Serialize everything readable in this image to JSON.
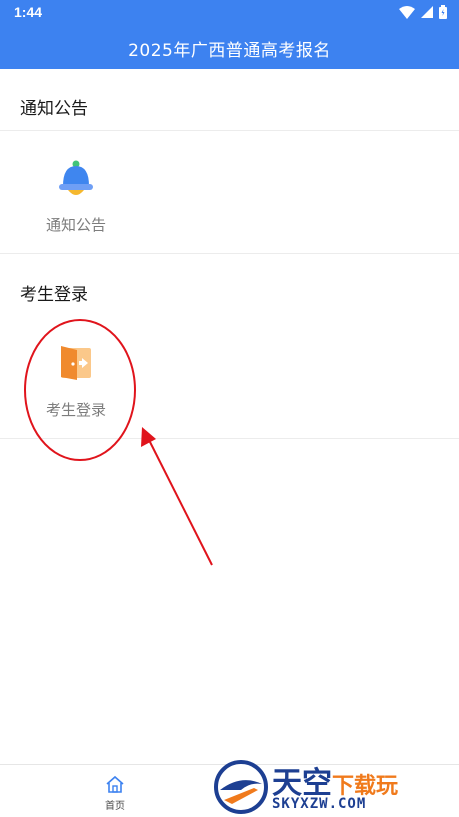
{
  "status_bar": {
    "time": "1:44"
  },
  "header": {
    "title": "2025年广西普通高考报名"
  },
  "sections": {
    "notice": {
      "title": "通知公告",
      "tile_label": "通知公告",
      "icon": "bell-icon"
    },
    "login": {
      "title": "考生登录",
      "tile_label": "考生登录",
      "icon": "door-login-icon"
    }
  },
  "bottom_nav": {
    "home_label": "首页",
    "icon": "home-icon"
  },
  "watermark": {
    "cn_main": "天空",
    "cn_accent": "下载玩",
    "en": "SKYXZW.COM"
  },
  "colors": {
    "header_bg": "#3d82f0",
    "annotation_red": "#e0141c",
    "icon_orange": "#f39b3a"
  }
}
